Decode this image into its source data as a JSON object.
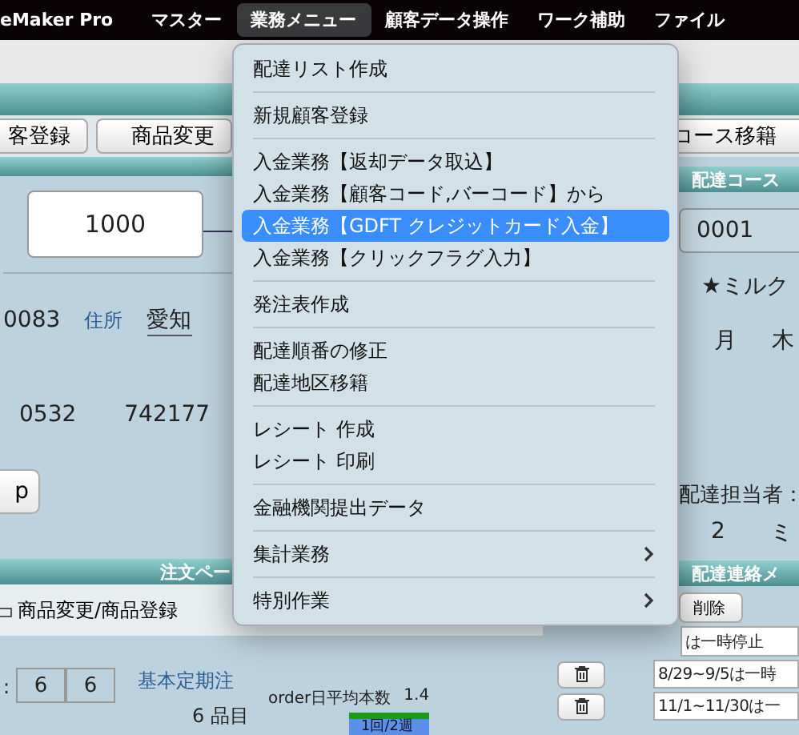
{
  "menubar": [
    {
      "label": "eMaker Pro",
      "kind": "app",
      "selected": false
    },
    {
      "label": "マスター",
      "kind": "menu",
      "selected": false
    },
    {
      "label": "業務メニュー",
      "kind": "menu",
      "selected": true
    },
    {
      "label": "顧客データ操作",
      "kind": "menu",
      "selected": false
    },
    {
      "label": "ワーク補助",
      "kind": "menu",
      "selected": false
    },
    {
      "label": "ファイル",
      "kind": "menu",
      "selected": false
    }
  ],
  "dropdown": {
    "groups": [
      [
        {
          "label": "配達リスト作成",
          "selected": false,
          "submenu": false
        }
      ],
      [
        {
          "label": "新規顧客登録",
          "selected": false,
          "submenu": false
        }
      ],
      [
        {
          "label": "入金業務【返却データ取込】",
          "selected": false,
          "submenu": false
        },
        {
          "label": "入金業務【顧客コード,バーコード】から",
          "selected": false,
          "submenu": false
        },
        {
          "label": "入金業務【GDFT クレジットカード入金】",
          "selected": true,
          "submenu": false
        },
        {
          "label": "入金業務【クリックフラグ入力】",
          "selected": false,
          "submenu": false
        }
      ],
      [
        {
          "label": "発注表作成",
          "selected": false,
          "submenu": false
        }
      ],
      [
        {
          "label": "配達順番の修正",
          "selected": false,
          "submenu": false
        },
        {
          "label": "配達地区移籍",
          "selected": false,
          "submenu": false
        }
      ],
      [
        {
          "label": "レシート 作成",
          "selected": false,
          "submenu": false
        },
        {
          "label": "レシート 印刷",
          "selected": false,
          "submenu": false
        }
      ],
      [
        {
          "label": "金融機関提出データ",
          "selected": false,
          "submenu": false
        }
      ],
      [
        {
          "label": "集計業務",
          "selected": false,
          "submenu": true
        }
      ],
      [
        {
          "label": "特別作業",
          "selected": false,
          "submenu": true
        }
      ]
    ]
  },
  "tabs": {
    "left": [
      "客登録",
      "商品変更"
    ],
    "right": "コース移籍"
  },
  "customer": {
    "code": "1000",
    "zip": "0083",
    "address_label": "住所",
    "address": "愛知",
    "phone_1": "0532",
    "phone_2": "742177",
    "button": "p"
  },
  "course": {
    "header": "配達コース",
    "code": "0001",
    "name": "★ミルク",
    "days": [
      "月",
      "木"
    ],
    "staff_label": "配達担当者：",
    "staff_no": "2",
    "staff_name": "ミ"
  },
  "order": {
    "header": "注文ペー",
    "change_button": "商品変更/商品登録",
    "colon": ":",
    "counts": [
      "6",
      "6"
    ],
    "regular_label": "基本定期注",
    "items": "6 品目",
    "avg_label": "order日平均本数",
    "avg_value": "1.4",
    "frequency": "1回/2週"
  },
  "notes": {
    "header": "配達連絡メ",
    "delete_button": "削除",
    "rows": [
      "は一時停止",
      "8/29~9/5は一時",
      "11/1~11/30は一"
    ]
  }
}
